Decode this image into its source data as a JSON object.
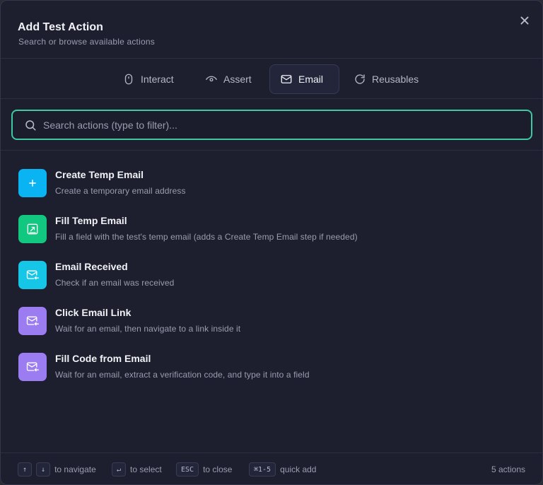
{
  "dialog": {
    "title": "Add Test Action",
    "subtitle": "Search or browse available actions"
  },
  "tabs": [
    {
      "label": "Interact",
      "icon": "mouse-icon"
    },
    {
      "label": "Assert",
      "icon": "eye-icon"
    },
    {
      "label": "Email",
      "icon": "mail-icon",
      "active": true
    },
    {
      "label": "Reusables",
      "icon": "refresh-icon"
    }
  ],
  "search": {
    "placeholder": "Search actions (type to filter)...",
    "value": ""
  },
  "actions": [
    {
      "title": "Create Temp Email",
      "description": "Create a temporary email address",
      "icon": "plus-icon",
      "color": "#0ab4f2"
    },
    {
      "title": "Fill Temp Email",
      "description": "Fill a field with the test's temp email (adds a Create Temp Email step if needed)",
      "icon": "fill-field-icon",
      "color": "#12c77f"
    },
    {
      "title": "Email Received",
      "description": "Check if an email was received",
      "icon": "mail-in-icon",
      "color": "#15c6e7"
    },
    {
      "title": "Click Email Link",
      "description": "Wait for an email, then navigate to a link inside it",
      "icon": "mail-in-icon",
      "color": "#9b7cf1"
    },
    {
      "title": "Fill Code from Email",
      "description": "Wait for an email, extract a verification code, and type it into a field",
      "icon": "mail-in-icon",
      "color": "#9b7cf1"
    }
  ],
  "footer": {
    "navigate_keys": [
      "↑",
      "↓"
    ],
    "navigate_label": "to navigate",
    "select_key": "↵",
    "select_label": "to select",
    "close_key": "ESC",
    "close_label": "to close",
    "quick_key": "⌘1-5",
    "quick_label": "quick add",
    "count": "5 actions"
  }
}
